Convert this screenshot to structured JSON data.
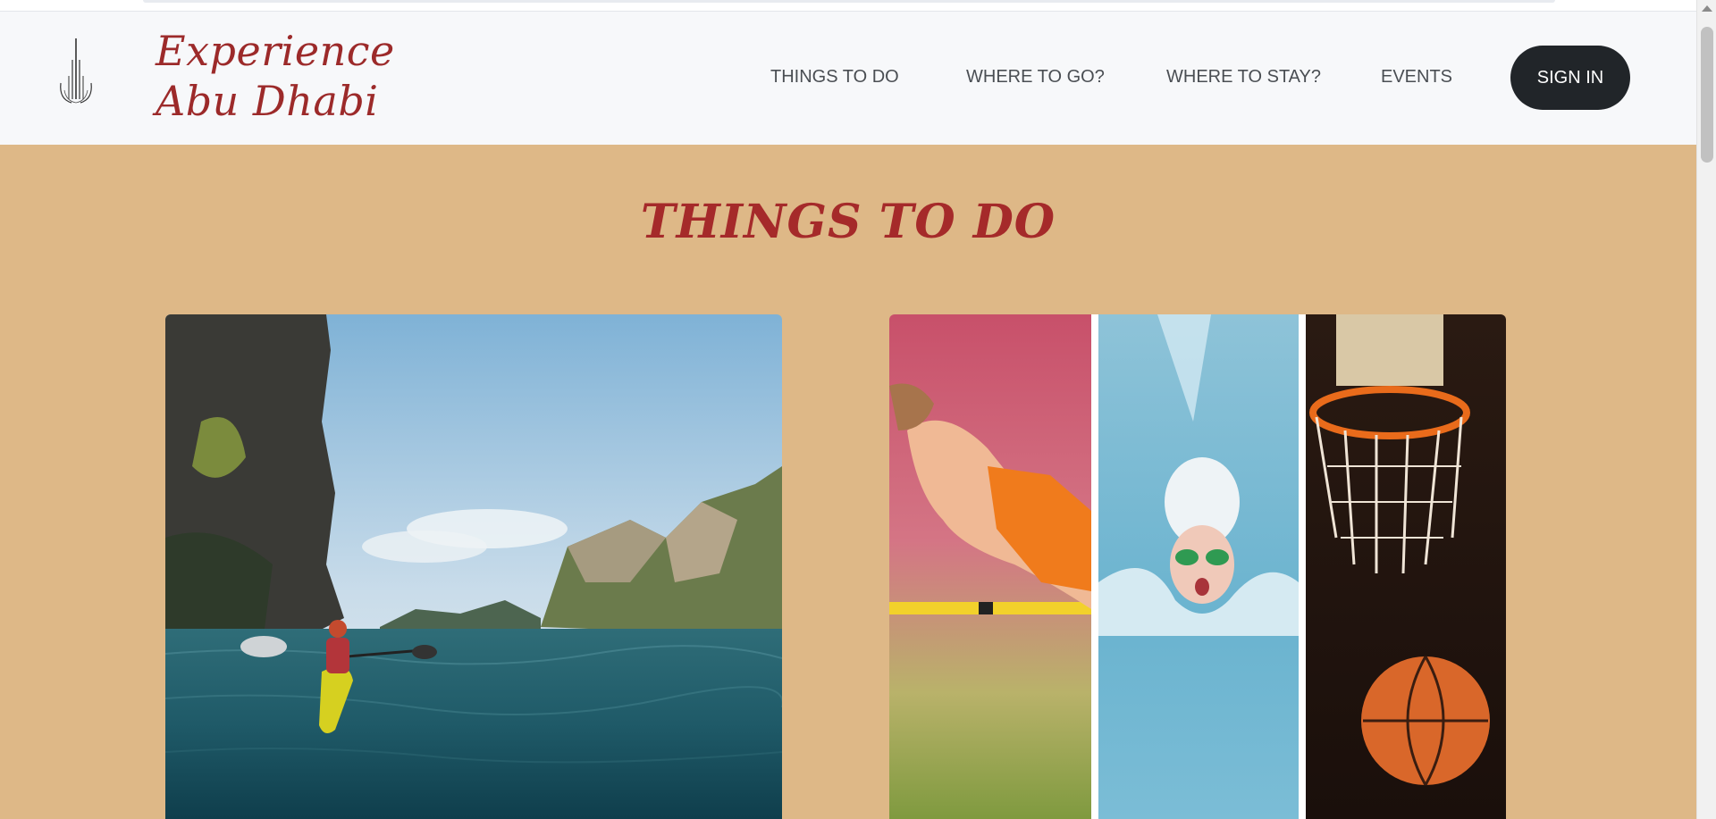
{
  "brand": {
    "line1": "Experience",
    "line2": "Abu Dhabi",
    "logo_icon": "burj-khalifa-icon",
    "brand_color": "#9c2a2a"
  },
  "nav": {
    "items": [
      {
        "label": "THINGS TO DO"
      },
      {
        "label": "WHERE TO GO?"
      },
      {
        "label": "WHERE TO STAY?"
      },
      {
        "label": "EVENTS"
      }
    ],
    "signin_label": "SIGN IN"
  },
  "main": {
    "section_title": "THINGS TO DO",
    "background_color": "#deb887",
    "cards": [
      {
        "image": "kayaking-photo"
      },
      {
        "image": "sports-collage-photo"
      }
    ]
  },
  "colors": {
    "navbar_bg": "#f7f8fa",
    "title_color": "#a52a2a",
    "button_bg": "#212529"
  }
}
